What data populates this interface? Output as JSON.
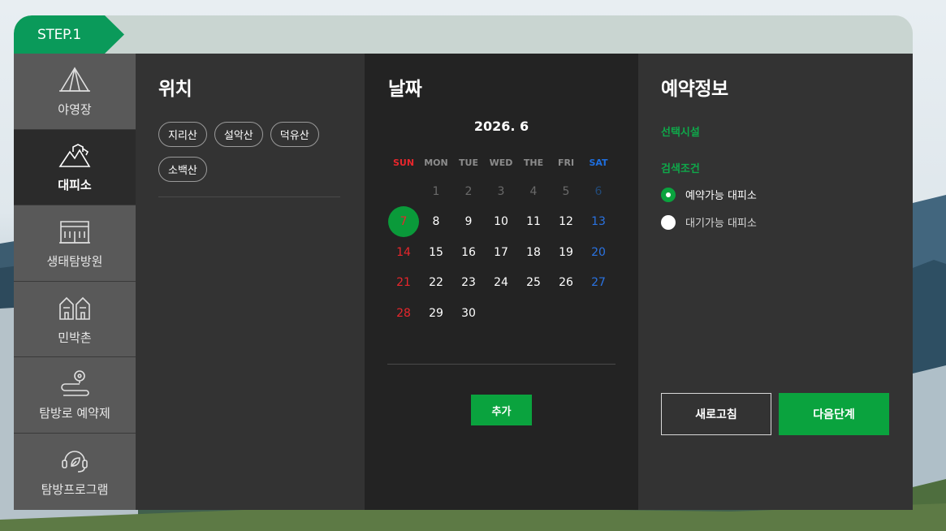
{
  "step": {
    "label": "STEP.1"
  },
  "sidebar": {
    "items": [
      {
        "label": "야영장",
        "icon": "tent-icon",
        "active": false
      },
      {
        "label": "대피소",
        "icon": "shelter-icon",
        "active": true
      },
      {
        "label": "생태탐방원",
        "icon": "building-icon",
        "active": false
      },
      {
        "label": "민박촌",
        "icon": "houses-icon",
        "active": false
      },
      {
        "label": "탐방로 예약제",
        "icon": "trail-pin-icon",
        "active": false
      },
      {
        "label": "탐방프로그램",
        "icon": "headset-leaf-icon",
        "active": false
      }
    ]
  },
  "location": {
    "title": "위치",
    "chips": [
      "지리산",
      "설악산",
      "덕유산",
      "소백산"
    ]
  },
  "date": {
    "title": "날짜",
    "month": "2026. 6",
    "weekdays": [
      "SUN",
      "MON",
      "TUE",
      "WED",
      "THE",
      "FRI",
      "SAT"
    ],
    "weeks": [
      [
        "",
        "1",
        "2",
        "3",
        "4",
        "5",
        "6"
      ],
      [
        "7",
        "8",
        "9",
        "10",
        "11",
        "12",
        "13"
      ],
      [
        "14",
        "15",
        "16",
        "17",
        "18",
        "19",
        "20"
      ],
      [
        "21",
        "22",
        "23",
        "24",
        "25",
        "26",
        "27"
      ],
      [
        "28",
        "29",
        "30",
        "",
        "",
        "",
        ""
      ]
    ],
    "today": "7",
    "add_label": "추가"
  },
  "info": {
    "title": "예약정보",
    "facility_label": "선택시설",
    "condition_label": "검색조건",
    "options": [
      {
        "label": "예약가능 대피소",
        "selected": true
      },
      {
        "label": "대기가능 대피소",
        "selected": false
      }
    ],
    "refresh_label": "새로고침",
    "next_label": "다음단계"
  },
  "colors": {
    "accent": "#0aa33e",
    "sunday": "#e8262c",
    "saturday": "#2a73e2"
  }
}
